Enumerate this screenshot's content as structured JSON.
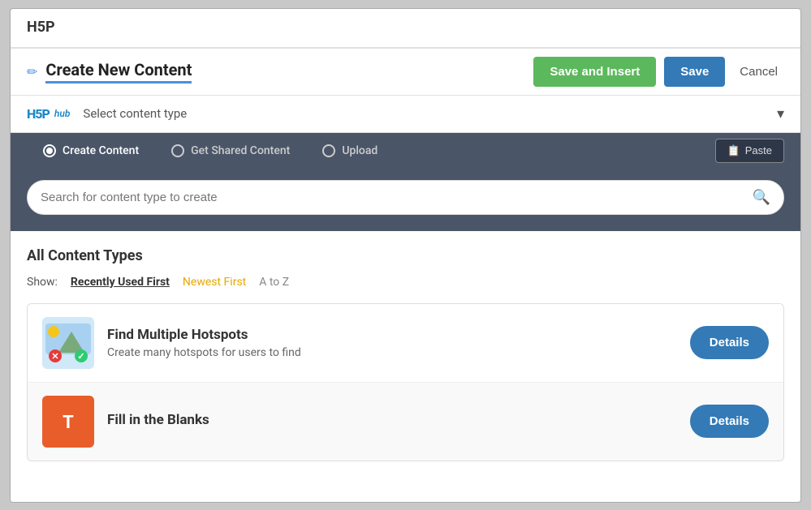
{
  "window": {
    "title": "H5P"
  },
  "toolbar": {
    "pencil_icon": "✏",
    "title": "Create New Content",
    "save_insert_label": "Save and Insert",
    "save_label": "Save",
    "cancel_label": "Cancel"
  },
  "hub": {
    "logo_h5p": "H5P",
    "logo_sub": "hub",
    "select_text": "Select content type",
    "chevron": "▾"
  },
  "tabs": [
    {
      "label": "Create Content",
      "active": true
    },
    {
      "label": "Get Shared Content",
      "active": false
    },
    {
      "label": "Upload",
      "active": false
    }
  ],
  "paste_button": {
    "label": "Paste",
    "icon": "📋"
  },
  "search": {
    "placeholder": "Search for content type to create"
  },
  "content_types": {
    "section_title": "All Content Types",
    "show_label": "Show:",
    "sort_options": [
      {
        "label": "Recently Used First",
        "active": true
      },
      {
        "label": "Newest First",
        "active": false,
        "color": "yellow"
      },
      {
        "label": "A to Z",
        "active": false
      }
    ],
    "items": [
      {
        "title": "Find Multiple Hotspots",
        "description": "Create many hotspots for users to find",
        "details_label": "Details"
      },
      {
        "title": "Fill in the Blanks",
        "description": "",
        "details_label": "Details"
      }
    ]
  }
}
